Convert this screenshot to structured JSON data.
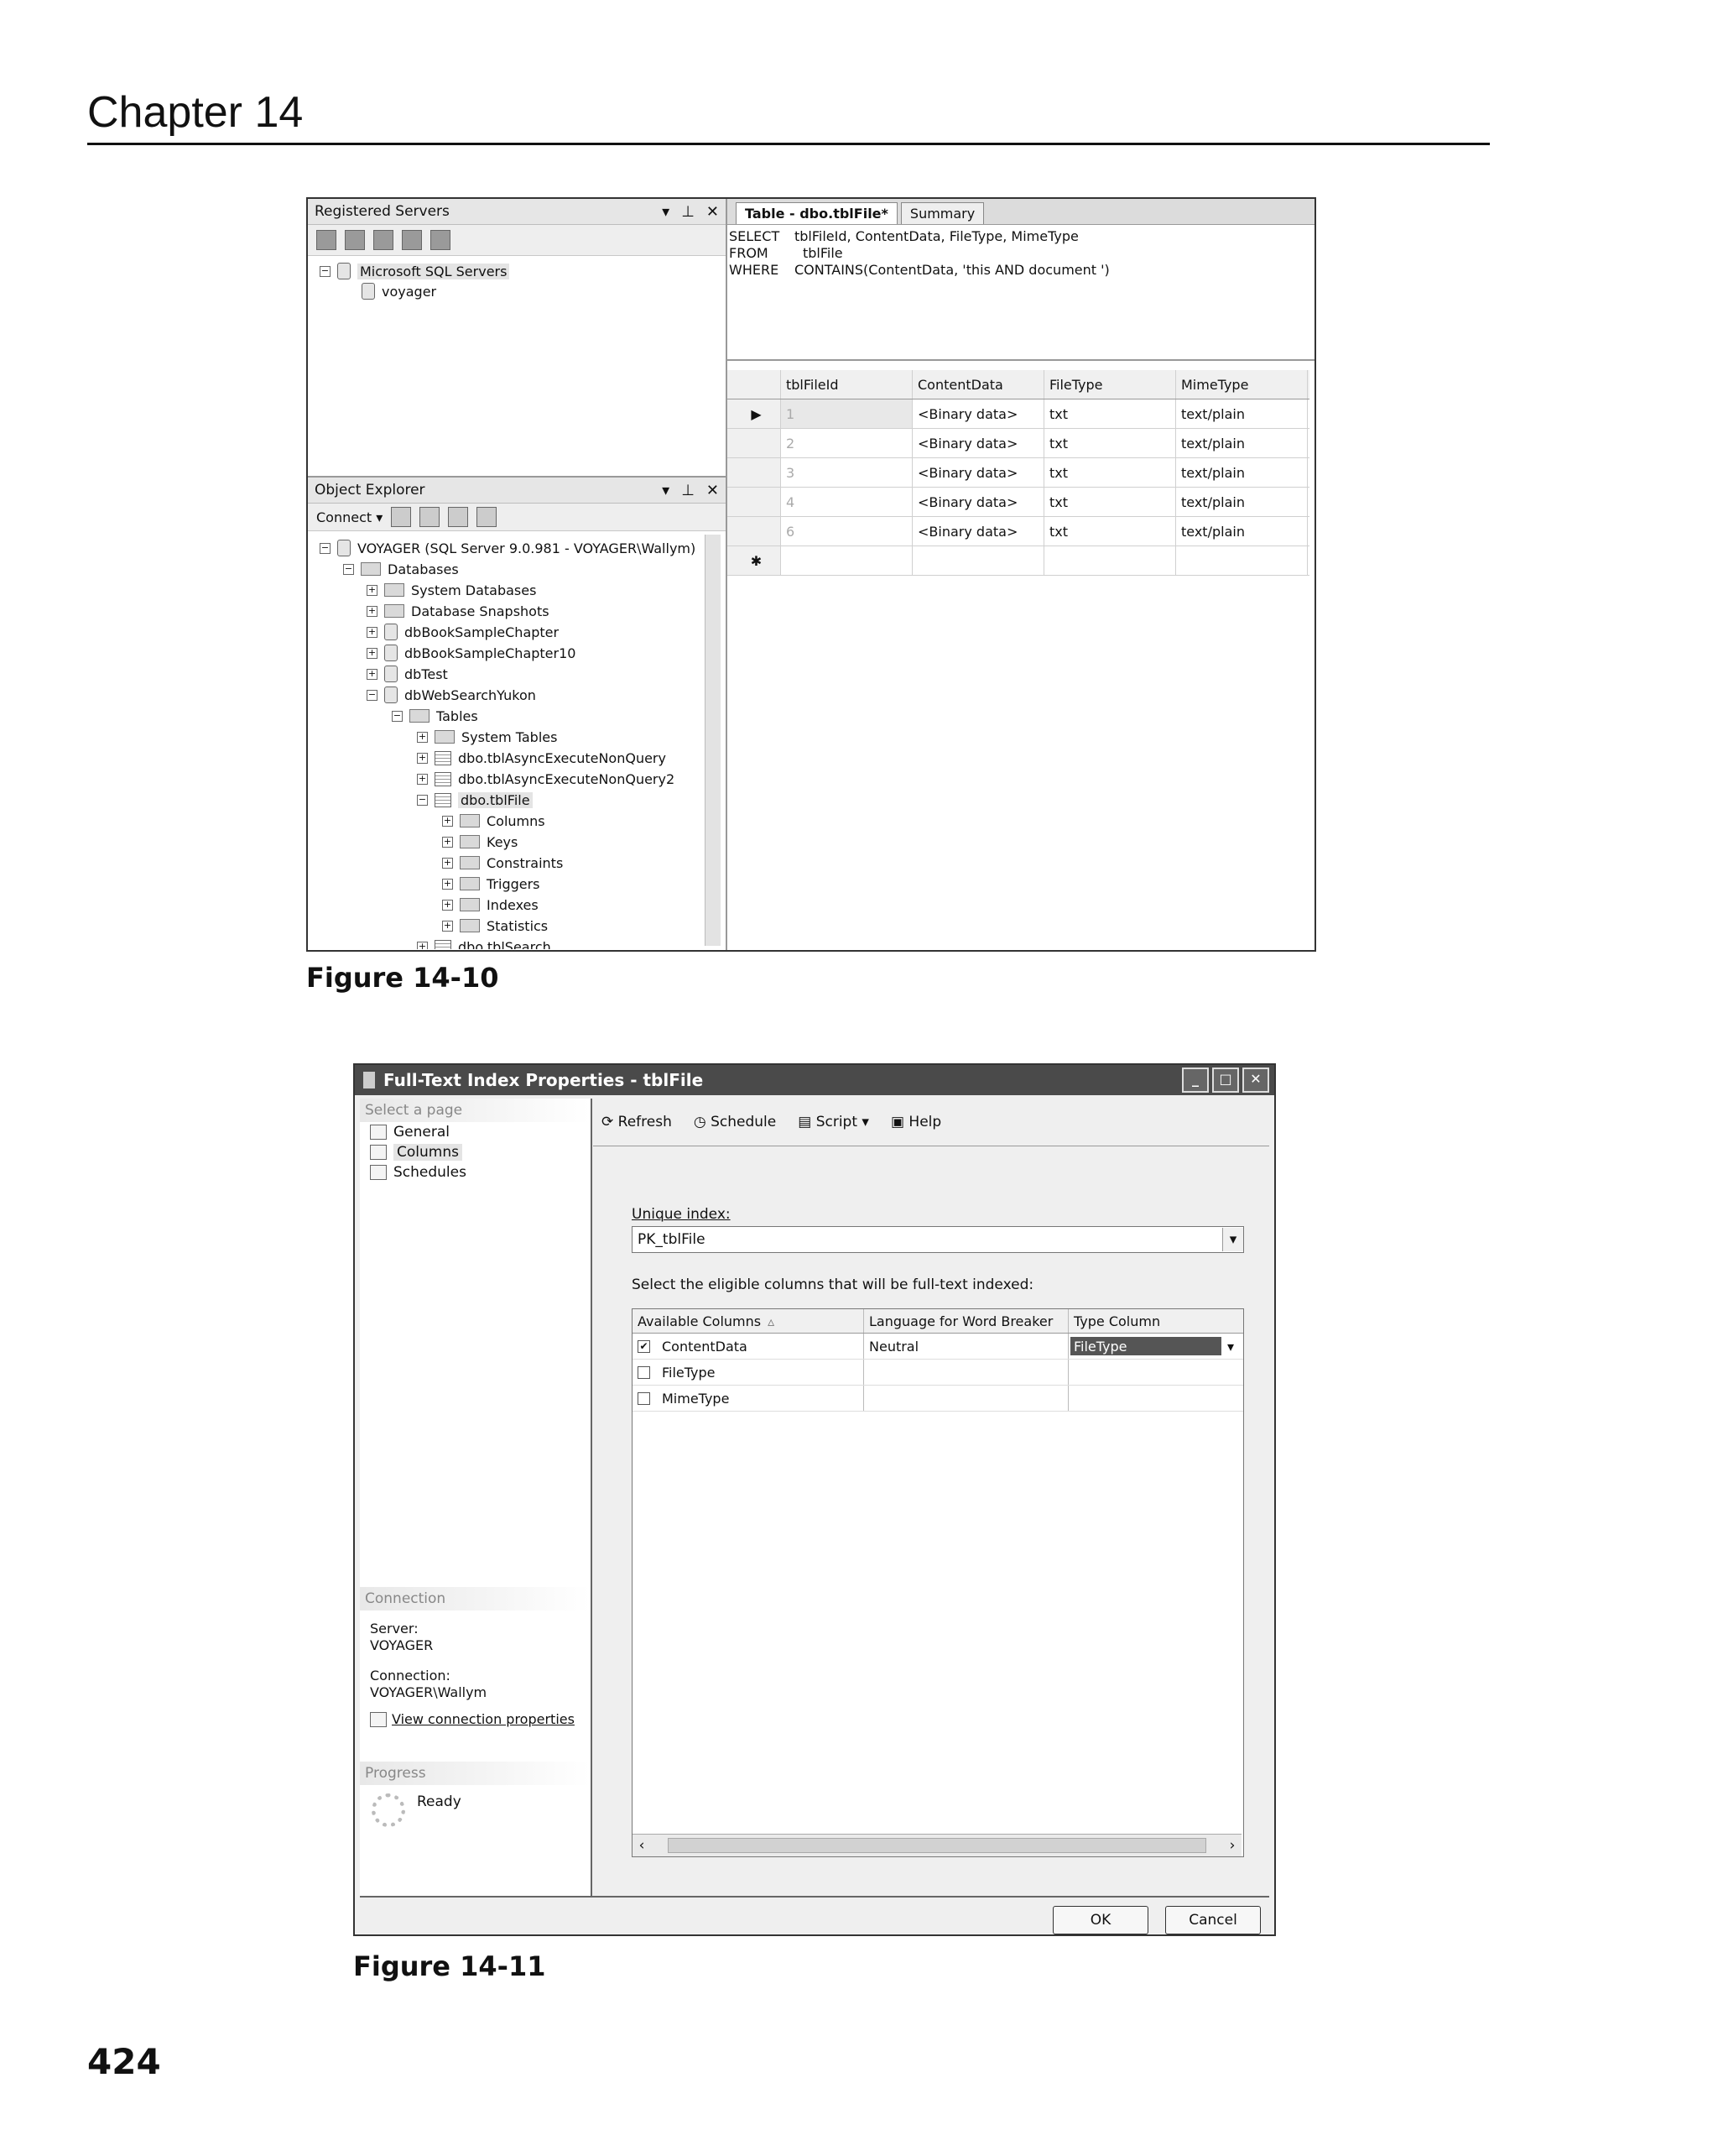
{
  "page": {
    "chapter_title": "Chapter 14",
    "page_number": "424",
    "fig10_caption": "Figure 14-10",
    "fig11_caption": "Figure 14-11"
  },
  "fig10": {
    "registered_servers": {
      "title": "Registered Servers",
      "tree": [
        "Microsoft SQL Servers",
        "voyager"
      ]
    },
    "object_explorer": {
      "title": "Object Explorer",
      "connect_label": "Connect ▾",
      "tree": [
        "VOYAGER (SQL Server 9.0.981 - VOYAGER\\Wallym)",
        "Databases",
        "System Databases",
        "Database Snapshots",
        "dbBookSampleChapter",
        "dbBookSampleChapter10",
        "dbTest",
        "dbWebSearchYukon",
        "Tables",
        "System Tables",
        "dbo.tblAsyncExecuteNonQuery",
        "dbo.tblAsyncExecuteNonQuery2",
        "dbo.tblFile",
        "Columns",
        "Keys",
        "Constraints",
        "Triggers",
        "Indexes",
        "Statistics",
        "dbo.tblSearch"
      ]
    },
    "tabs": [
      "Table - dbo.tblFile*",
      "Summary"
    ],
    "sql": {
      "kw1": "SELECT",
      "line1": "tblFileId, ContentData, FileType, MimeType",
      "kw2": "FROM",
      "line2": "tblFile",
      "kw3": "WHERE",
      "line3": "CONTAINS(ContentData, 'this AND document ')"
    },
    "grid": {
      "headers": [
        "tblFileId",
        "ContentData",
        "FileType",
        "MimeType"
      ],
      "rows": [
        [
          "1",
          "<Binary data>",
          "txt",
          "text/plain"
        ],
        [
          "2",
          "<Binary data>",
          "txt",
          "text/plain"
        ],
        [
          "3",
          "<Binary data>",
          "txt",
          "text/plain"
        ],
        [
          "4",
          "<Binary data>",
          "txt",
          "text/plain"
        ],
        [
          "6",
          "<Binary data>",
          "txt",
          "text/plain"
        ]
      ],
      "new_row_marker": "✱",
      "current_row_marker": "▶"
    }
  },
  "fig11": {
    "title": "Full-Text Index Properties - tblFile",
    "select_page": "Select a page",
    "pages": [
      "General",
      "Columns",
      "Schedules"
    ],
    "toolbar": {
      "refresh": "Refresh",
      "schedule": "Schedule",
      "script": "Script",
      "help": "Help"
    },
    "unique_index_label": "Unique index:",
    "unique_index_value": "PK_tblFile",
    "eligible_label": "Select the eligible columns that will be full-text indexed:",
    "columns_headers": [
      "Available Columns",
      "Language for Word Breaker",
      "Type Column"
    ],
    "columns_rows": [
      {
        "checked": "✔",
        "name": "ContentData",
        "language": "Neutral",
        "type": "FileType"
      },
      {
        "checked": "",
        "name": "FileType",
        "language": "",
        "type": ""
      },
      {
        "checked": "",
        "name": "MimeType",
        "language": "",
        "type": ""
      }
    ],
    "connection": {
      "head": "Connection",
      "server_label": "Server:",
      "server": "VOYAGER",
      "conn_label": "Connection:",
      "conn": "VOYAGER\\Wallym",
      "link": "View connection properties"
    },
    "progress": {
      "head": "Progress",
      "status": "Ready"
    },
    "ok": "OK",
    "cancel": "Cancel"
  }
}
